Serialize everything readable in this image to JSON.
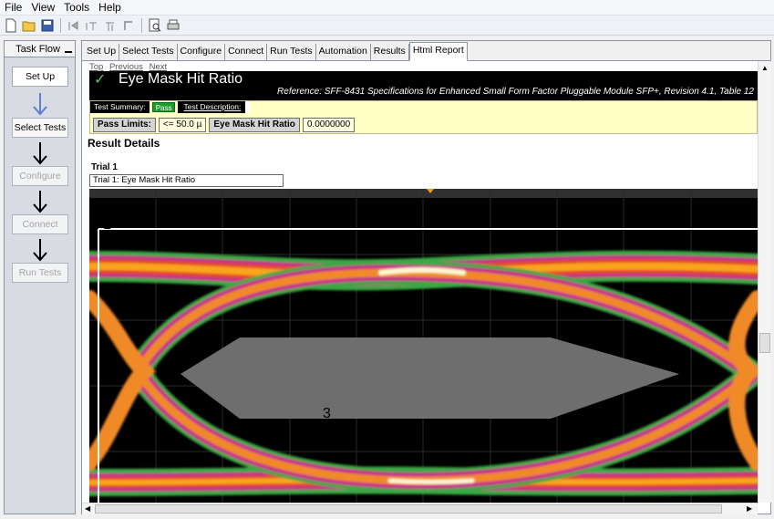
{
  "menu": {
    "items": [
      "File",
      "View",
      "Tools",
      "Help"
    ]
  },
  "toolbar": {
    "icons": [
      "new-file-icon",
      "open-folder-icon",
      "save-icon",
      "run-icon",
      "step-icon",
      "step-over-icon",
      "stop-icon",
      "print-preview-icon",
      "print-icon"
    ]
  },
  "taskflow": {
    "title": "Task Flow",
    "steps": [
      {
        "label": "Set Up",
        "state": "active"
      },
      {
        "label": "Select Tests",
        "state": "enabled"
      },
      {
        "label": "Configure",
        "state": "disabled"
      },
      {
        "label": "Connect",
        "state": "disabled"
      },
      {
        "label": "Run Tests",
        "state": "disabled"
      }
    ]
  },
  "tabs": [
    "Set Up",
    "Select Tests",
    "Configure",
    "Connect",
    "Run Tests",
    "Automation",
    "Results",
    "Html Report"
  ],
  "active_tab": "Html Report",
  "report": {
    "nav": {
      "top": "Top",
      "previous": "Previous",
      "next": "Next"
    },
    "title": "Eye Mask Hit Ratio",
    "reference": "Reference: SFF-8431 Specifications for Enhanced Small Form Factor Pluggable Module SFP+, Revision 4.1, Table 12",
    "summary_label": "Test Summary:",
    "summary_status": "Pass",
    "description_label": "Test Description:",
    "pass_limits_label": "Pass Limits:",
    "pass_limits_value": "<= 50.0 µ",
    "result_label": "Eye Mask Hit Ratio",
    "result_value": "0.0000000",
    "result_details": "Result Details",
    "trial_heading": "Trial 1",
    "trial_caption": "Trial 1: Eye Mask Hit Ratio",
    "marker_1": "1",
    "marker_3": "3"
  },
  "colors": {
    "accent_green": "#1b9a2e",
    "title_bg": "#000000",
    "summary_bg": "#ffffc6",
    "mask_gray": "#6e6e6e"
  }
}
